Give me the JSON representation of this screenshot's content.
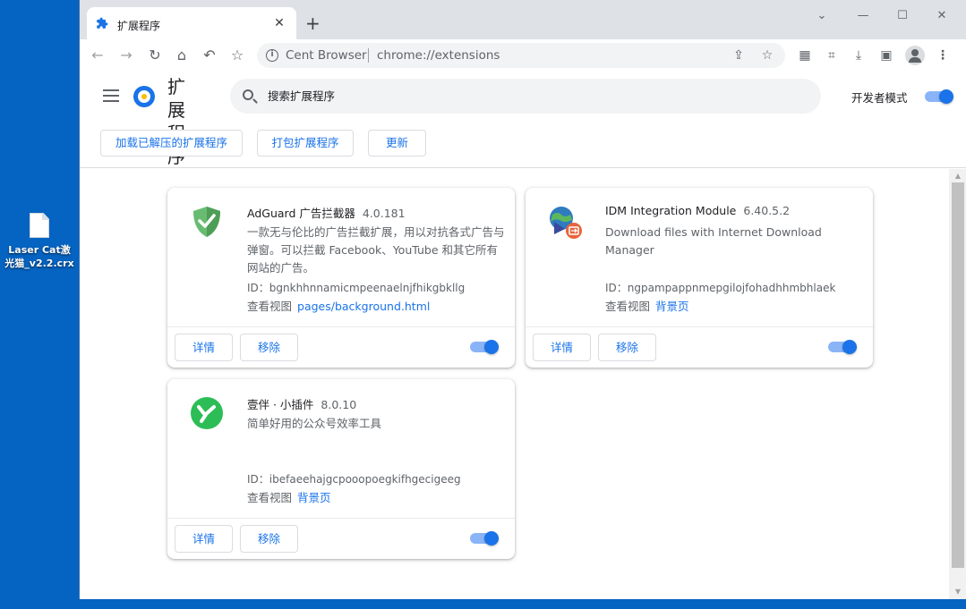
{
  "desktop": {
    "file_name": "Laser Cat激光猫_v2.2.crx"
  },
  "browser": {
    "tab_title": "扩展程序",
    "new_tab_symbol": "+",
    "site_name": "Cent Browser",
    "url": "chrome://extensions"
  },
  "header": {
    "title": "扩展程序",
    "search_placeholder": "搜索扩展程序",
    "dev_mode_label": "开发者模式",
    "dev_mode_on": true,
    "buttons": {
      "load_unpacked": "加载已解压的扩展程序",
      "pack": "打包扩展程序",
      "update": "更新"
    }
  },
  "extensions": [
    {
      "name": "AdGuard 广告拦截器",
      "version": "4.0.181",
      "description": "一款无与伦比的广告拦截扩展，用以对抗各式广告与弹窗。可以拦截 Facebook、YouTube 和其它所有网站的广告。",
      "id_label": "ID：bgnkhhnnamicmpeenaelnjfhikgbkllg",
      "view_label": "查看视图",
      "view_link": "pages/background.html",
      "details_label": "详情",
      "remove_label": "移除",
      "enabled": true,
      "icon": "adguard-shield-icon",
      "color": "#68bc71"
    },
    {
      "name": "IDM Integration Module",
      "version": "6.40.5.2",
      "description": "Download files with Internet Download Manager",
      "id_label": "ID：ngpampappnmepgilojfohadhhmbhlaek",
      "view_label": "查看视图",
      "view_link": "背景页",
      "details_label": "详情",
      "remove_label": "移除",
      "enabled": true,
      "icon": "idm-globe-icon",
      "color": "#e8643c"
    },
    {
      "name": "壹伴 · 小插件",
      "version": "8.0.10",
      "description": "简单好用的公众号效率工具",
      "id_label": "ID：ibefaeehajgcpooopoegkifhgecigeeg",
      "view_label": "查看视图",
      "view_link": "背景页",
      "details_label": "详情",
      "remove_label": "移除",
      "enabled": true,
      "icon": "yiban-logo-icon",
      "color": "#2dbd56"
    }
  ]
}
